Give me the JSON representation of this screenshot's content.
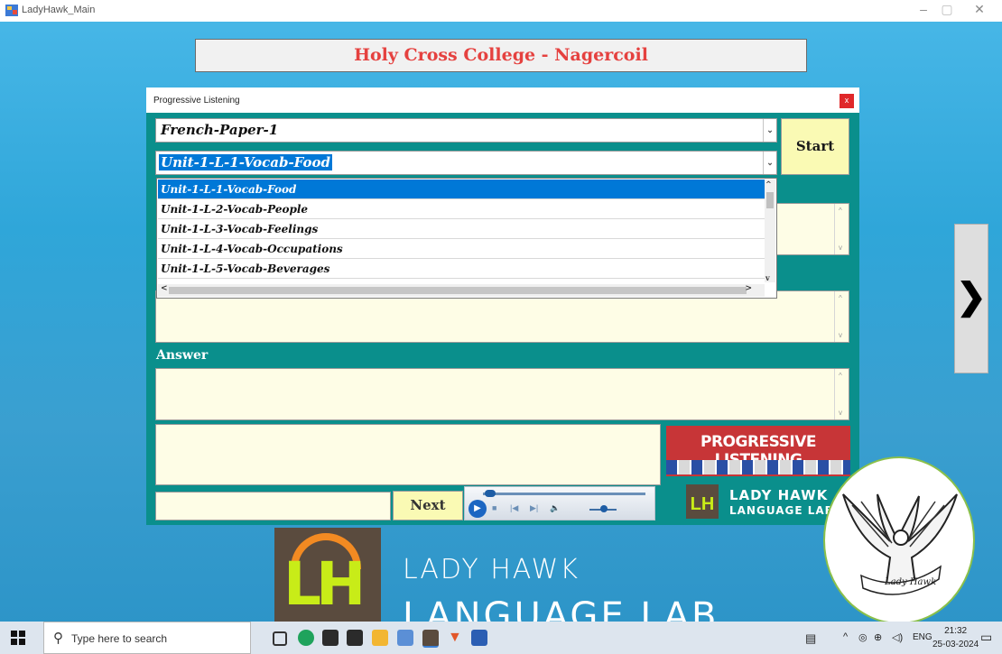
{
  "window": {
    "title": "LadyHawk_Main"
  },
  "college_banner": "Holy Cross College - Nagercoil",
  "brand": {
    "line1": "LADY HAWK",
    "line2": "LANGUAGE LAB"
  },
  "dialog": {
    "title": "Progressive Listening",
    "close": "x",
    "paper_combo": "French-Paper-1",
    "lesson_combo": "Unit-1-L-1-Vocab-Food",
    "start": "Start",
    "answer_label": "Answer",
    "next": "Next",
    "dropdown_items": [
      "Unit-1-L-1-Vocab-Food",
      "Unit-1-L-2-Vocab-People",
      "Unit-1-L-3-Vocab-Feelings",
      "Unit-1-L-4-Vocab-Occupations",
      "Unit-1-L-5-Vocab-Beverages"
    ],
    "logo_banner": "PROGRESSIVE LISTENING",
    "logo_line1": "LADY HAWK",
    "logo_line2": "LANGUAGE LAB",
    "logo_mini": "LH"
  },
  "big_logo": "LH",
  "hawk_caption": "Lady Hawk",
  "taskbar": {
    "search_placeholder": "Type here to search",
    "lang": "ENG",
    "time": "21:32",
    "date": "25-03-2024"
  },
  "colors": {
    "dialog_bg": "#0a8f8c",
    "banner_text": "#e5413f",
    "input_bg": "#fefde6",
    "button_bg": "#fafab4",
    "highlight": "#0078d7"
  }
}
